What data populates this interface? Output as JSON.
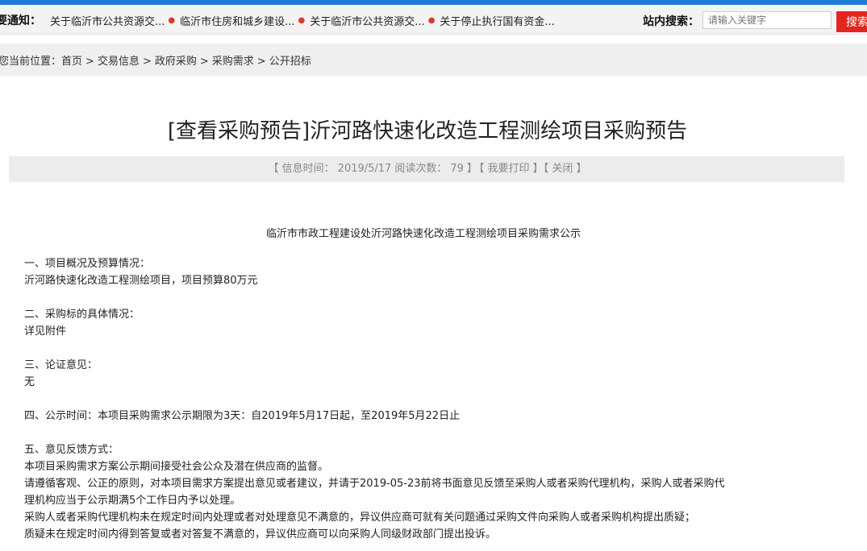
{
  "topbar": {
    "notice_label": "要通知：",
    "notices": [
      "关于临沂市公共资源交...",
      "临沂市住房和城乡建设...",
      "关于临沂市公共资源交...",
      "关于停止执行国有资金..."
    ],
    "search_label": "站内搜索：",
    "search_placeholder": "请输入关键字",
    "search_button": "搜索"
  },
  "breadcrumb": {
    "prefix": "您当前位置：",
    "items": [
      "首页",
      "交易信息",
      "政府采购",
      "采购需求",
      "公开招标"
    ],
    "separator": ">"
  },
  "article": {
    "title": "[查看采购预告]沂河路快速化改造工程测绘项目采购预告",
    "meta": {
      "time_label": "【 信息时间：",
      "time_value": "2019/5/17",
      "views_label": "阅读次数：",
      "views_value": "79",
      "views_close": "】",
      "print": "【 我要打印 】",
      "close": "【 关闭 】"
    },
    "subtitle": "临沂市市政工程建设处沂河路快速化改造工程测绘项目采购需求公示",
    "lines": [
      "一、项目概况及预算情况：",
      "沂河路快速化改造工程测绘项目，项目预算80万元",
      "",
      "二、采购标的具体情况：",
      "详见附件",
      "",
      "三、论证意见：",
      "无",
      "",
      "四、公示时间：本项目采购需求公示期限为3天：自2019年5月17日起，至2019年5月22日止",
      "",
      "五、意见反馈方式：",
      "本项目采购需求方案公示期间接受社会公众及潜在供应商的监督。",
      "请遵循客观、公正的原则，对本项目需求方案提出意见或者建议，并请于2019-05-23前将书面意见反馈至采购人或者采购代理机构，采购人或者采购代",
      "理机构应当于公示期满5个工作日内予以处理。",
      "采购人或者采购代理机构未在规定时间内处理或者对处理意见不满意的，异议供应商可就有关问题通过采购文件向采购人或者采购机构提出质疑；",
      "质疑未在规定时间内得到答复或者对答复不满意的，异议供应商可以向采购人同级财政部门提出投诉。"
    ]
  }
}
